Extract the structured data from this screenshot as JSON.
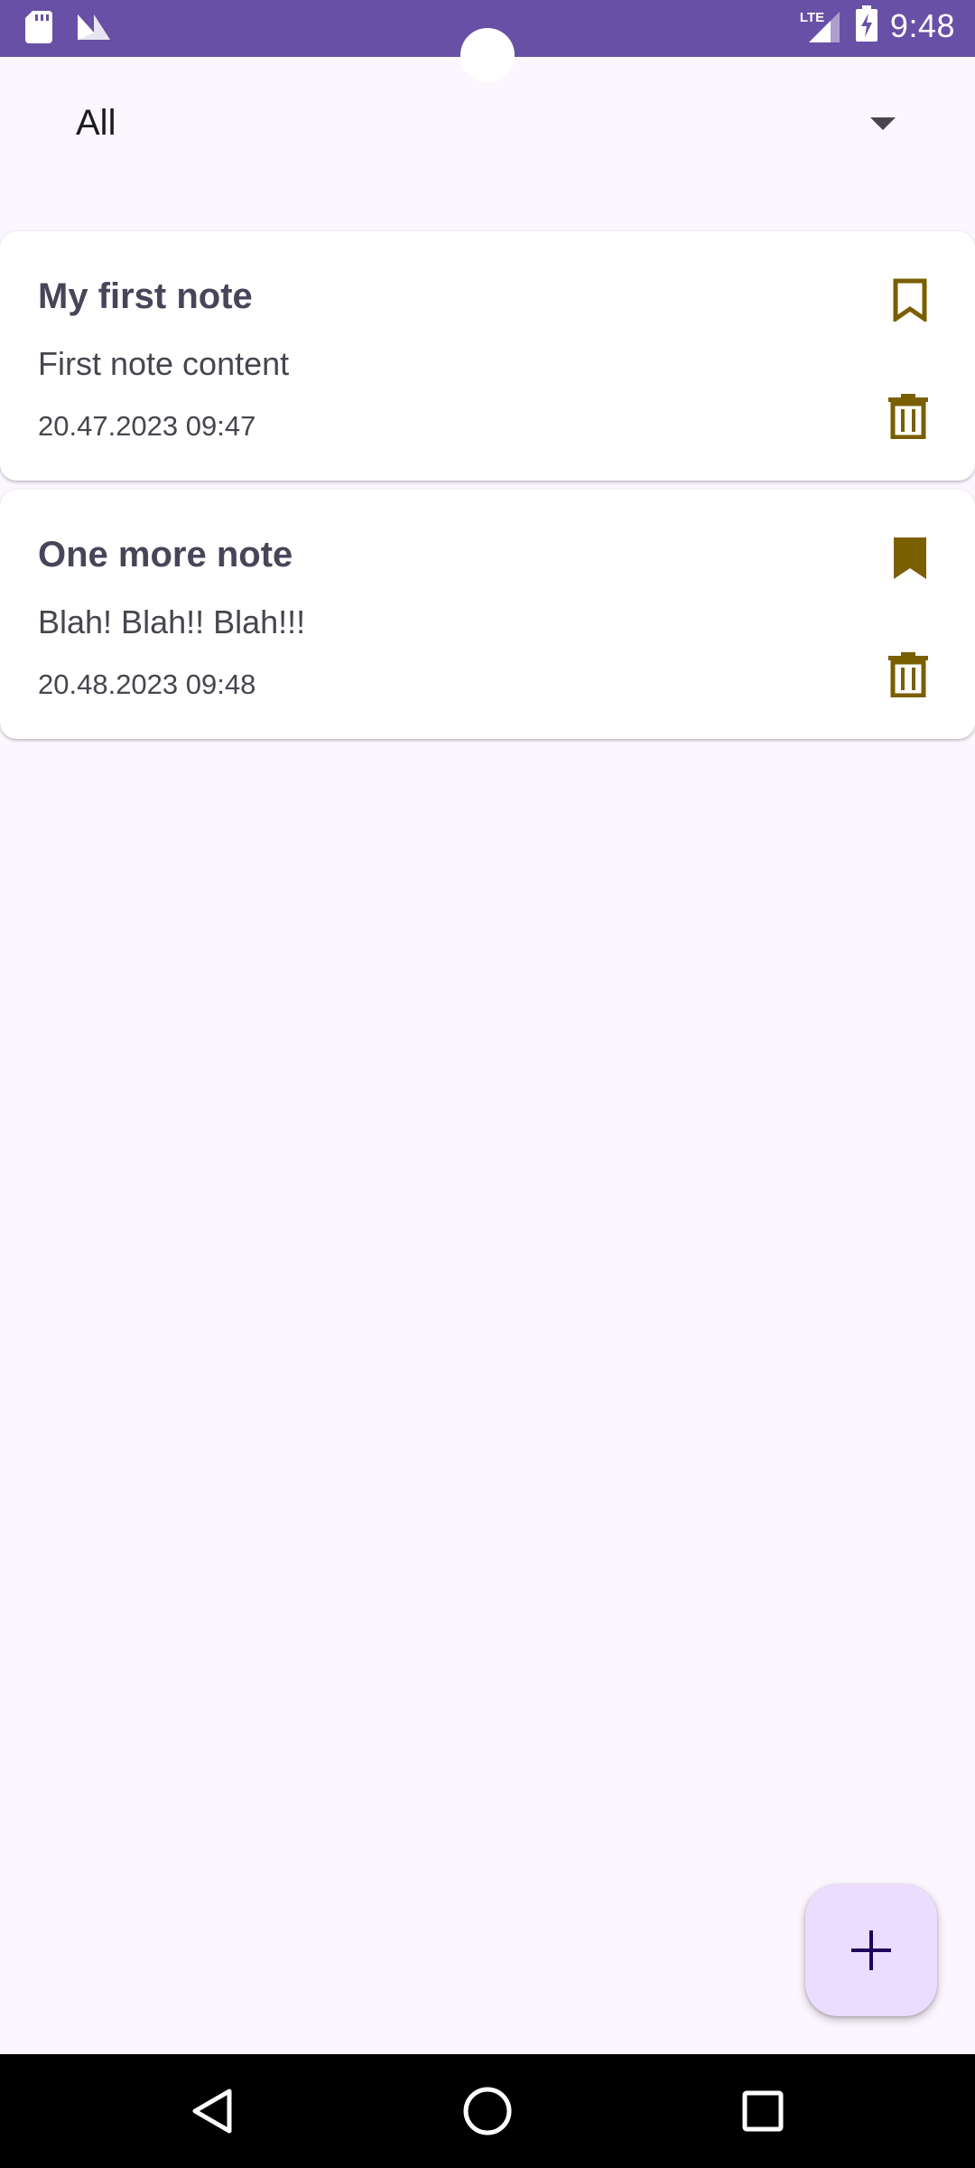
{
  "status_bar": {
    "time": "9:48",
    "network": "LTE",
    "left_icons": [
      "sd-card-icon",
      "n-logo-icon"
    ],
    "right_icons": [
      "lte-signal-icon",
      "battery-charging-icon"
    ],
    "background": "#6850A6"
  },
  "filter": {
    "selected": "All",
    "icon": "dropdown-arrow-icon"
  },
  "notes": [
    {
      "title": "My first note",
      "content": "First note content",
      "date": "20.47.2023 09:47",
      "bookmarked": false
    },
    {
      "title": "One more note",
      "content": "Blah! Blah!! Blah!!!",
      "date": "20.48.2023 09:48",
      "bookmarked": true
    }
  ],
  "fab": {
    "icon": "plus-icon",
    "background": "#EADDFF",
    "icon_color": "#21005D"
  },
  "navigation": {
    "back_icon": "back-triangle-icon",
    "home_icon": "home-circle-icon",
    "recents_icon": "recents-square-icon"
  },
  "colors": {
    "background": "#FCF7FE",
    "card": "#FFFFFF",
    "accent_icon": "#7A5F00",
    "title_text": "#4A4459"
  }
}
